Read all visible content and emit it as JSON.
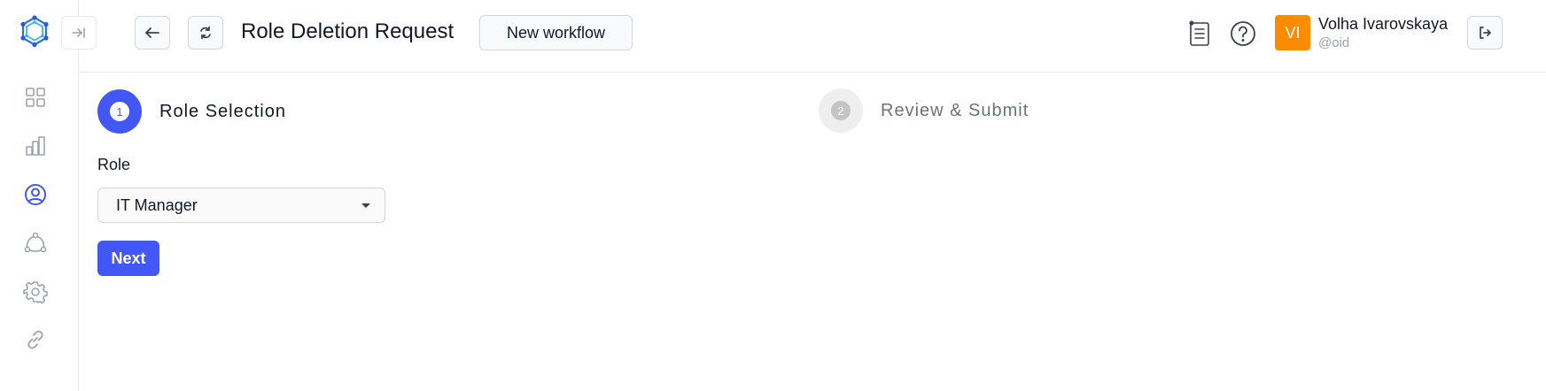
{
  "header": {
    "title": "Role Deletion Request",
    "new_workflow_label": "New workflow",
    "user": {
      "initials": "VI",
      "name": "Volha Ivarovskaya",
      "handle": "@oid",
      "avatar_color": "#fb8c00"
    }
  },
  "sidebar": {
    "items": [
      {
        "icon": "dashboard-grid-icon"
      },
      {
        "icon": "bar-chart-icon"
      },
      {
        "icon": "user-circle-icon",
        "active": true
      },
      {
        "icon": "network-icon"
      },
      {
        "icon": "gear-icon"
      },
      {
        "icon": "link-icon"
      }
    ]
  },
  "stepper": {
    "steps": [
      {
        "number": "1",
        "label": "Role Selection",
        "active": true
      },
      {
        "number": "2",
        "label": "Review & Submit",
        "active": false
      }
    ]
  },
  "form": {
    "role_label": "Role",
    "role_value": "IT Manager",
    "next_label": "Next"
  },
  "colors": {
    "primary": "#4257f5",
    "border": "#e5e7eb",
    "avatar": "#fb8c00"
  }
}
